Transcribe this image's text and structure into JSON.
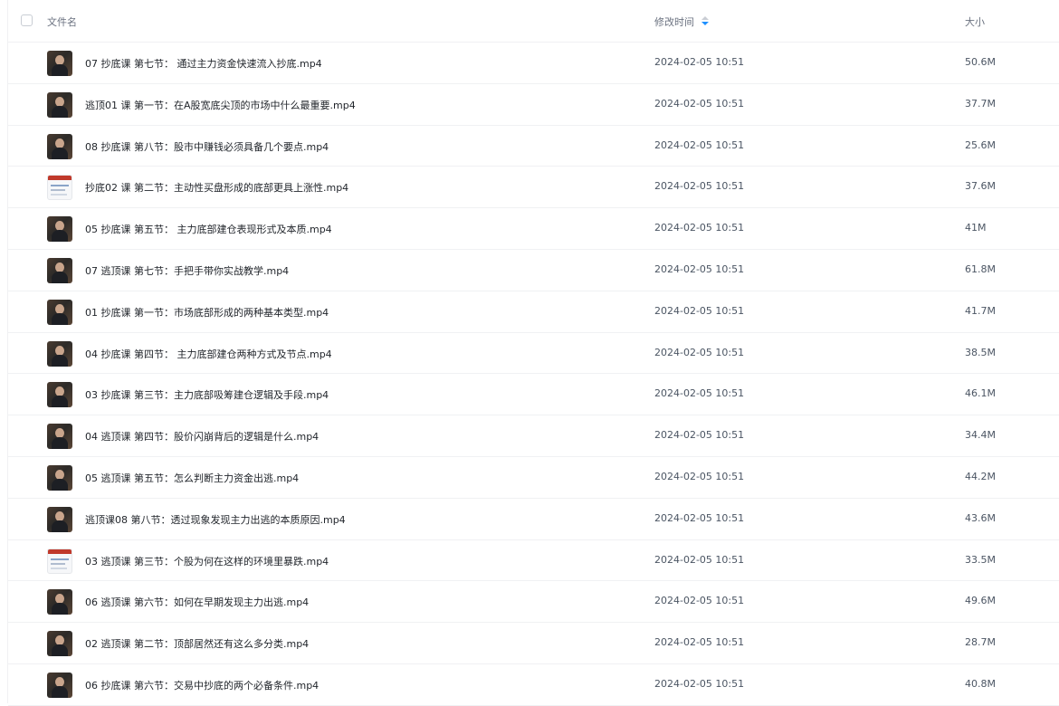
{
  "header": {
    "name_label": "文件名",
    "time_label": "修改时间",
    "size_label": "大小"
  },
  "files": [
    {
      "name": "07 抄底课 第七节： 通过主力资金快速流入抄底.mp4",
      "time": "2024-02-05 10:51",
      "size": "50.6M",
      "thumb": "video-thumbnail-icon"
    },
    {
      "name": "逃顶01 课 第一节：在A股宽底尖顶的市场中什么最重要.mp4",
      "time": "2024-02-05 10:51",
      "size": "37.7M",
      "thumb": "video-thumbnail-icon"
    },
    {
      "name": "08 抄底课 第八节：股市中赚钱必须具备几个要点.mp4",
      "time": "2024-02-05 10:51",
      "size": "25.6M",
      "thumb": "video-thumbnail-icon"
    },
    {
      "name": "抄底02 课 第二节：主动性买盘形成的底部更具上涨性.mp4",
      "time": "2024-02-05 10:51",
      "size": "37.6M",
      "thumb": "chart-thumbnail-icon"
    },
    {
      "name": "05 抄底课 第五节： 主力底部建仓表现形式及本质.mp4",
      "time": "2024-02-05 10:51",
      "size": "41M",
      "thumb": "video-thumbnail-icon"
    },
    {
      "name": "07 逃顶课 第七节：手把手带你实战教学.mp4",
      "time": "2024-02-05 10:51",
      "size": "61.8M",
      "thumb": "video-thumbnail-icon"
    },
    {
      "name": "01 抄底课 第一节：市场底部形成的两种基本类型.mp4",
      "time": "2024-02-05 10:51",
      "size": "41.7M",
      "thumb": "video-thumbnail-icon"
    },
    {
      "name": "04 抄底课 第四节： 主力底部建仓两种方式及节点.mp4",
      "time": "2024-02-05 10:51",
      "size": "38.5M",
      "thumb": "video-thumbnail-icon"
    },
    {
      "name": "03 抄底课 第三节：主力底部吸筹建仓逻辑及手段.mp4",
      "time": "2024-02-05 10:51",
      "size": "46.1M",
      "thumb": "video-thumbnail-icon"
    },
    {
      "name": "04 逃顶课 第四节：股价闪崩背后的逻辑是什么.mp4",
      "time": "2024-02-05 10:51",
      "size": "34.4M",
      "thumb": "video-thumbnail-icon"
    },
    {
      "name": "05 逃顶课 第五节：怎么判断主力资金出逃.mp4",
      "time": "2024-02-05 10:51",
      "size": "44.2M",
      "thumb": "video-thumbnail-icon"
    },
    {
      "name": "逃顶课08 第八节：透过现象发现主力出逃的本质原因.mp4",
      "time": "2024-02-05 10:51",
      "size": "43.6M",
      "thumb": "video-thumbnail-icon"
    },
    {
      "name": "03 逃顶课 第三节：个股为何在这样的环境里暴跌.mp4",
      "time": "2024-02-05 10:51",
      "size": "33.5M",
      "thumb": "chart-thumbnail-icon"
    },
    {
      "name": "06 逃顶课 第六节：如何在早期发现主力出逃.mp4",
      "time": "2024-02-05 10:51",
      "size": "49.6M",
      "thumb": "video-thumbnail-icon"
    },
    {
      "name": "02 逃顶课 第二节：顶部居然还有这么多分类.mp4",
      "time": "2024-02-05 10:51",
      "size": "28.7M",
      "thumb": "video-thumbnail-icon"
    },
    {
      "name": "06 抄底课 第六节：交易中抄底的两个必备条件.mp4",
      "time": "2024-02-05 10:51",
      "size": "40.8M",
      "thumb": "video-thumbnail-icon"
    }
  ],
  "colors": {
    "sort_active": "#1e90ff",
    "divider": "#f0f1f3"
  }
}
